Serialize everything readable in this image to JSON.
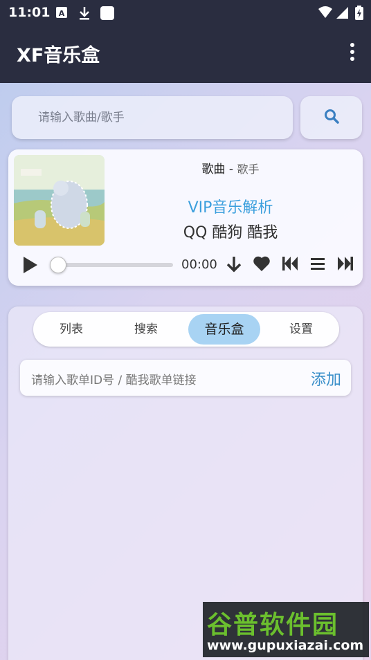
{
  "status_bar": {
    "time": "11:01",
    "icons": [
      "a-notification-icon",
      "download-icon",
      "square-icon",
      "wifi-icon",
      "signal-icon",
      "battery-icon"
    ]
  },
  "app_bar": {
    "title": "XF音乐盒",
    "menu_icon": "more-vert-icon"
  },
  "search": {
    "placeholder": "请输入歌曲/歌手",
    "button_icon": "search-icon"
  },
  "player": {
    "song": "歌曲",
    "separator": " - ",
    "artist": "歌手",
    "vip_title": "VIP音乐解析",
    "vip_sub": "QQ 酷狗 酷我",
    "time": "00:00",
    "progress": 0.0,
    "icons": [
      "play-icon",
      "download-icon",
      "heart-icon",
      "previous-icon",
      "playlist-icon",
      "next-icon"
    ]
  },
  "tabs": [
    {
      "label": "列表",
      "active": false
    },
    {
      "label": "搜索",
      "active": false
    },
    {
      "label": "音乐盒",
      "active": true
    },
    {
      "label": "设置",
      "active": false
    }
  ],
  "playlist_import": {
    "placeholder": "请输入歌单ID号 / 酷我歌单链接",
    "add_label": "添加"
  },
  "watermark": {
    "logo": "谷普软件园",
    "url": "www.gupuxiazai.com"
  },
  "colors": {
    "top_bar": "#2a2d40",
    "accent_blue": "#3b9fdd",
    "active_tab": "#a8d3f3"
  }
}
